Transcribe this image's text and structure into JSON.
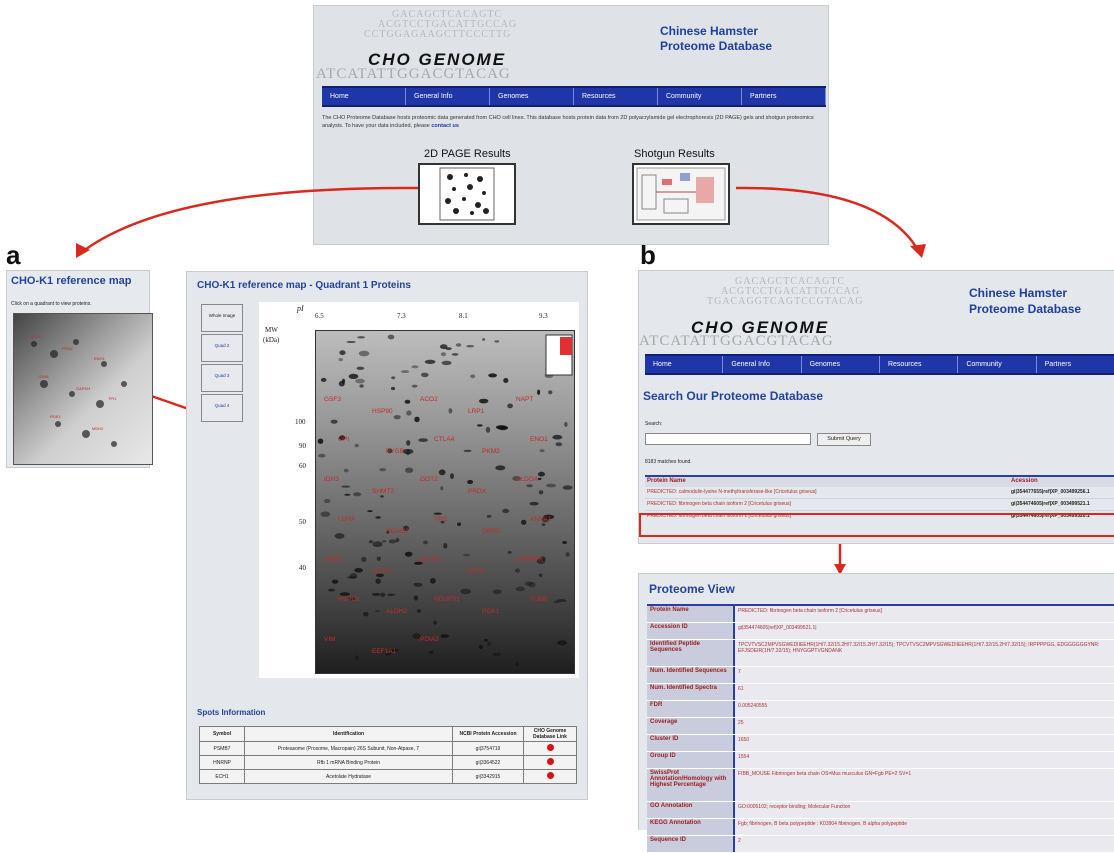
{
  "top": {
    "dna_lines": [
      "GACAGCTCACAGTC",
      "ACGTCCTGACATTGCCAG",
      "CCTGGAGAAGCTTCCCTTG",
      "TGACAGGTCAGTCCGTACAG",
      "ATCATATTGGACGTACAG"
    ],
    "logo": "CHO GENOME",
    "db_title": [
      "Chinese Hamster",
      "Proteome Database"
    ],
    "nav": [
      "Home",
      "General Info",
      "Genomes",
      "Resources",
      "Community",
      "Partners"
    ],
    "intro": "The CHO Proteome Database hosts proteomic data generated from CHO cell lines. This database hosts protein data from 2D polyacrylamide gel electrophoresis (2D PAGE) gels and shotgun proteomics analysis. To have your data included, please",
    "intro_link": "contact us",
    "results_2d": "2D PAGE Results",
    "results_shotgun": "Shotgun Results"
  },
  "panel_a": {
    "letter": "a",
    "ref_title": "CHO-K1 reference map",
    "ref_hint": "Click on a quadrant to view proteins.",
    "quad_title": "CHO-K1 reference map - Quadrant 1 Proteins",
    "side_buttons": [
      "Whole Image",
      "Quad 2",
      "Quad 3",
      "Quad 4"
    ],
    "gel": {
      "pi_label": "pI",
      "mw_label": "MW",
      "kda_label": "(kDa)",
      "pi_ticks": [
        "6.5",
        "7.3",
        "8.1",
        "9.3"
      ],
      "mw_ticks": [
        "100",
        "90",
        "60",
        "50",
        "40"
      ],
      "spot_labels": [
        "GSF3",
        "HSP90",
        "ACO2",
        "LRP1",
        "NAPT",
        "GPI",
        "PYGB",
        "CTLA4",
        "PKM2",
        "ENO1",
        "IDH3",
        "SHMT2",
        "GOT2",
        "PRDX",
        "ALDOA",
        "LDHA",
        "PGAM1",
        "TPI1",
        "G6PD",
        "ANXA1",
        "MDH2",
        "ACAT1",
        "ECHS1",
        "ETFA",
        "HNRNPK",
        "HSPD1",
        "ALDH2",
        "NDUFS1",
        "PGK1",
        "TUBB",
        "VIM",
        "EEF1A1",
        "PDIA3"
      ]
    },
    "spots": {
      "title": "Spots Information",
      "headers": [
        "Symbol",
        "Identification",
        "NCBI Protein Accession",
        "CHO Genome Database Link"
      ],
      "rows": [
        [
          "PSMB7",
          "Proteasome (Prosome, Macropain) 26S Subunit, Non-Atpase, 7",
          "gi|3754719"
        ],
        [
          "HNRNP",
          "Rfb 1 mRNA Binding Protein",
          "gi|3364522"
        ],
        [
          "ECH1",
          "Acetolate Hydratase",
          "gi|3342915"
        ]
      ]
    }
  },
  "panel_b": {
    "letter": "b",
    "search_title": "Search Our Proteome Database",
    "search_label": "Search:",
    "search_value": "",
    "submit": "Submit Query",
    "matches": "8183 matches found.",
    "col_protein": "Protein Name",
    "col_accession": "Acession",
    "results": [
      [
        "PREDICTED: calmodulin-lysine N-methyltransferase-like [Cricetulus griseus]",
        "gi|354477655|ref|XP_003499256.1"
      ],
      [
        "PREDICTED: fibrinogen beta chain isoform 2 [Cricetulus griseus]",
        "gi|354474605|ref|XP_003499521.1"
      ],
      [
        "PREDICTED: fibrinogen beta chain isoform 1 [Cricetulus griseus]",
        "gi|354474603|ref|XP_003499520.1"
      ]
    ],
    "pv_title": "Proteome View",
    "pv_rows": [
      [
        "Protein Name",
        "PREDICTED: fibrinogen beta chain isoform 2 [Cricetulus griseus]"
      ],
      [
        "Accession ID",
        "gi|354474605|ref|XP_003499521.1|"
      ],
      [
        "Identified Peptide Sequences",
        "TPCVTVSC2MPVSGWEDIIEEHR(1H/7.32/15.2H/7.32/15.2H/7.32/15); TPCVTVSC2MPVSGWEDIIEEHR(1H/7.32/15.2H/7.32/15); IRPPPPGG, EDGGGGGGYNR: EFJSDEIR(1H/7.32/15); HNYGGPTVGNDANK"
      ],
      [
        "Num. Identified Sequences",
        "7"
      ],
      [
        "Num. Identified Spectra",
        "61"
      ],
      [
        "FDR",
        "0.005240555"
      ],
      [
        "Coverage",
        "25"
      ],
      [
        "Cluster ID",
        "1650"
      ],
      [
        "Group ID",
        "1554"
      ],
      [
        "SwissProt Annotation/Homology with Highest Percentage",
        "FIBB_MOUSE Fibrinogen beta chain OS=Mus musculus GN=Fgb PE=2 SV=1"
      ],
      [
        "GO Annotation",
        "GO:0005102; receptor binding; Molecular Function"
      ],
      [
        "KEGG Annotation",
        "Fgb; fibrinogen, B beta polypeptide ; K03904 fibrinogen, B alpha polypeptide"
      ],
      [
        "Sequence ID",
        "2"
      ]
    ]
  },
  "colors": {
    "accent_blue": "#1f36a8",
    "title_blue": "#23449a",
    "arrow_red": "#d9281e"
  }
}
